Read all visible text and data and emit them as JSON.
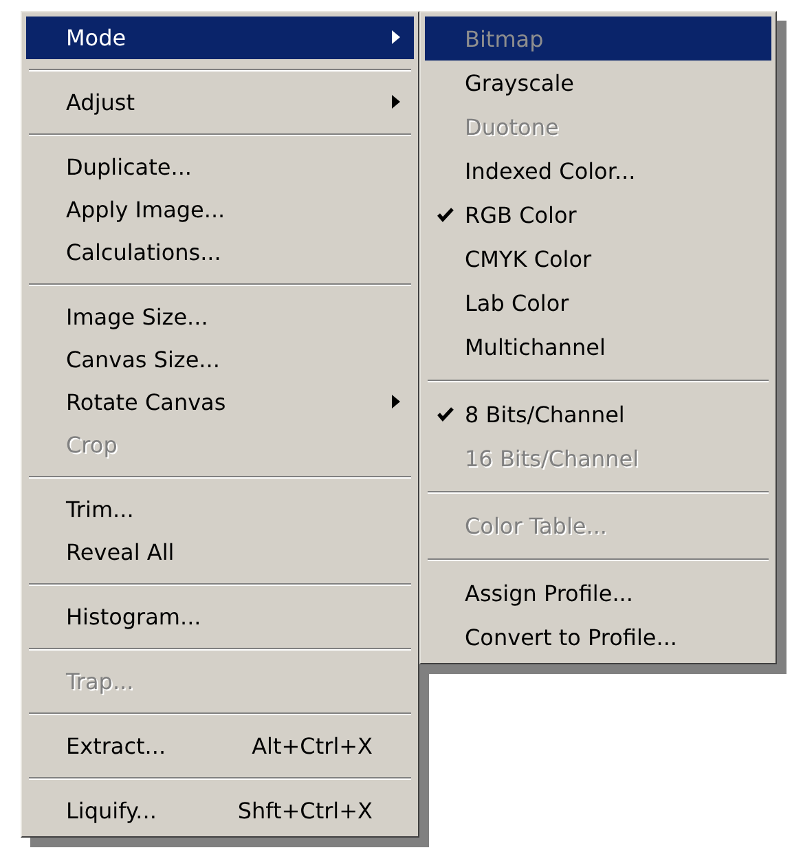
{
  "menu": {
    "items": [
      {
        "kind": "item",
        "label": "Mode",
        "selected": true,
        "disabled": false,
        "submenu": true
      },
      {
        "kind": "separator"
      },
      {
        "kind": "item",
        "label": "Adjust",
        "selected": false,
        "disabled": false,
        "submenu": true
      },
      {
        "kind": "separator"
      },
      {
        "kind": "item",
        "label": "Duplicate...",
        "selected": false,
        "disabled": false,
        "submenu": false
      },
      {
        "kind": "item",
        "label": "Apply Image...",
        "selected": false,
        "disabled": false,
        "submenu": false
      },
      {
        "kind": "item",
        "label": "Calculations...",
        "selected": false,
        "disabled": false,
        "submenu": false
      },
      {
        "kind": "separator"
      },
      {
        "kind": "item",
        "label": "Image Size...",
        "selected": false,
        "disabled": false,
        "submenu": false
      },
      {
        "kind": "item",
        "label": "Canvas Size...",
        "selected": false,
        "disabled": false,
        "submenu": false
      },
      {
        "kind": "item",
        "label": "Rotate Canvas",
        "selected": false,
        "disabled": false,
        "submenu": true
      },
      {
        "kind": "item",
        "label": "Crop",
        "selected": false,
        "disabled": true,
        "submenu": false
      },
      {
        "kind": "separator"
      },
      {
        "kind": "item",
        "label": "Trim...",
        "selected": false,
        "disabled": false,
        "submenu": false
      },
      {
        "kind": "item",
        "label": "Reveal All",
        "selected": false,
        "disabled": false,
        "submenu": false
      },
      {
        "kind": "separator"
      },
      {
        "kind": "item",
        "label": "Histogram...",
        "selected": false,
        "disabled": false,
        "submenu": false
      },
      {
        "kind": "separator"
      },
      {
        "kind": "item",
        "label": "Trap...",
        "selected": false,
        "disabled": true,
        "submenu": false
      },
      {
        "kind": "separator"
      },
      {
        "kind": "item",
        "label": "Extract...",
        "shortcut": "Alt+Ctrl+X",
        "selected": false,
        "disabled": false,
        "submenu": false
      },
      {
        "kind": "separator"
      },
      {
        "kind": "item",
        "label": "Liquify...",
        "shortcut": "Shft+Ctrl+X",
        "selected": false,
        "disabled": false,
        "submenu": false
      }
    ]
  },
  "submenu": {
    "items": [
      {
        "kind": "item",
        "label": "Bitmap",
        "selected": true,
        "disabled": true,
        "checked": false
      },
      {
        "kind": "item",
        "label": "Grayscale",
        "selected": false,
        "disabled": false,
        "checked": false
      },
      {
        "kind": "item",
        "label": "Duotone",
        "selected": false,
        "disabled": true,
        "checked": false
      },
      {
        "kind": "item",
        "label": "Indexed Color...",
        "selected": false,
        "disabled": false,
        "checked": false
      },
      {
        "kind": "item",
        "label": "RGB Color",
        "selected": false,
        "disabled": false,
        "checked": true
      },
      {
        "kind": "item",
        "label": "CMYK Color",
        "selected": false,
        "disabled": false,
        "checked": false
      },
      {
        "kind": "item",
        "label": "Lab Color",
        "selected": false,
        "disabled": false,
        "checked": false
      },
      {
        "kind": "item",
        "label": "Multichannel",
        "selected": false,
        "disabled": false,
        "checked": false
      },
      {
        "kind": "separator"
      },
      {
        "kind": "item",
        "label": "8 Bits/Channel",
        "selected": false,
        "disabled": false,
        "checked": true
      },
      {
        "kind": "item",
        "label": "16 Bits/Channel",
        "selected": false,
        "disabled": true,
        "checked": false
      },
      {
        "kind": "separator"
      },
      {
        "kind": "item",
        "label": "Color Table...",
        "selected": false,
        "disabled": true,
        "checked": false
      },
      {
        "kind": "separator"
      },
      {
        "kind": "item",
        "label": "Assign Profile...",
        "selected": false,
        "disabled": false,
        "checked": false
      },
      {
        "kind": "item",
        "label": "Convert to Profile...",
        "selected": false,
        "disabled": false,
        "checked": false
      }
    ]
  }
}
